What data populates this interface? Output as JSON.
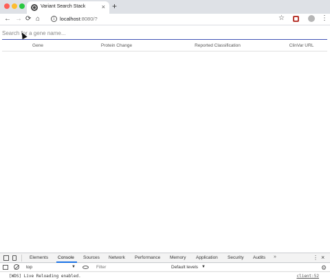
{
  "browser": {
    "tab_title": "Variant Search Stack",
    "tab_close": "×",
    "new_tab": "+",
    "url_host": "localhost",
    "url_path": ":8080/?",
    "info_glyph": "i"
  },
  "page": {
    "search_placeholder": "Search for a gene name...",
    "columns": [
      "Gene",
      "Protein Change",
      "Reported Classification",
      "ClinVar URL"
    ],
    "accent_color": "#3f51b5"
  },
  "devtools": {
    "tabs": [
      "Elements",
      "Console",
      "Sources",
      "Network",
      "Performance",
      "Memory",
      "Application",
      "Security",
      "Audits"
    ],
    "active_tab": "Console",
    "more_tabs": "»",
    "context": "top",
    "filter_placeholder": "Filter",
    "levels": "Default levels",
    "log_message": "[WDS] Live Reloading enabled.",
    "log_source": "client:52"
  },
  "icons": {
    "back": "arrow-left-icon",
    "forward": "arrow-right-icon",
    "reload": "reload-icon",
    "home": "home-icon",
    "star": "star-icon",
    "menu": "kebab-icon"
  }
}
